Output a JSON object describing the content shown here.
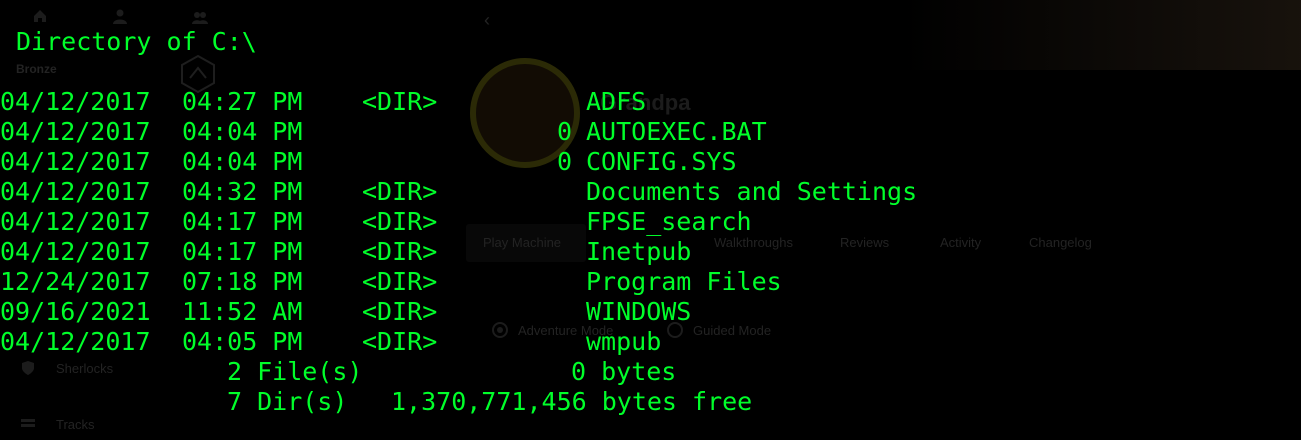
{
  "background_ui": {
    "nav_rank": "Bronze",
    "username": "Grandpa",
    "tabs": [
      "Play Machine",
      "Walkthroughs",
      "Reviews",
      "Activity",
      "Changelog"
    ],
    "modes": [
      "Adventure Mode",
      "Guided Mode"
    ],
    "sidebar_items": [
      "Sherlocks",
      "Tracks"
    ]
  },
  "terminal": {
    "header": "Directory of C:\\",
    "entries": [
      {
        "date": "04/12/2017",
        "time": "04:27 PM",
        "dir": "<DIR>",
        "size": "",
        "name": "ADFS"
      },
      {
        "date": "04/12/2017",
        "time": "04:04 PM",
        "dir": "",
        "size": "0",
        "name": "AUTOEXEC.BAT"
      },
      {
        "date": "04/12/2017",
        "time": "04:04 PM",
        "dir": "",
        "size": "0",
        "name": "CONFIG.SYS"
      },
      {
        "date": "04/12/2017",
        "time": "04:32 PM",
        "dir": "<DIR>",
        "size": "",
        "name": "Documents and Settings"
      },
      {
        "date": "04/12/2017",
        "time": "04:17 PM",
        "dir": "<DIR>",
        "size": "",
        "name": "FPSE_search"
      },
      {
        "date": "04/12/2017",
        "time": "04:17 PM",
        "dir": "<DIR>",
        "size": "",
        "name": "Inetpub"
      },
      {
        "date": "12/24/2017",
        "time": "07:18 PM",
        "dir": "<DIR>",
        "size": "",
        "name": "Program Files"
      },
      {
        "date": "09/16/2021",
        "time": "11:52 AM",
        "dir": "<DIR>",
        "size": "",
        "name": "WINDOWS"
      },
      {
        "date": "04/12/2017",
        "time": "04:05 PM",
        "dir": "<DIR>",
        "size": "",
        "name": "wmpub"
      }
    ],
    "summary": {
      "files": "2 File(s)",
      "files_bytes": "0 bytes",
      "dirs": "7 Dir(s)",
      "dirs_bytes": "1,370,771,456 bytes free"
    },
    "colors": {
      "text": "#00ff2a",
      "background": "#000000"
    }
  }
}
